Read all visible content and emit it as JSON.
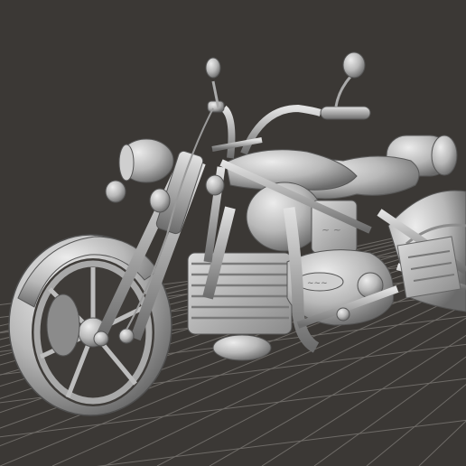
{
  "viewport": {
    "background": "#3b3835",
    "grid_color": "#6e6b67",
    "model_color": "#b9b9b9",
    "model_shadow": "#6f6f6f",
    "model_highlight": "#e6e6e6"
  },
  "model": {
    "icon": "motorcycle-icon"
  }
}
